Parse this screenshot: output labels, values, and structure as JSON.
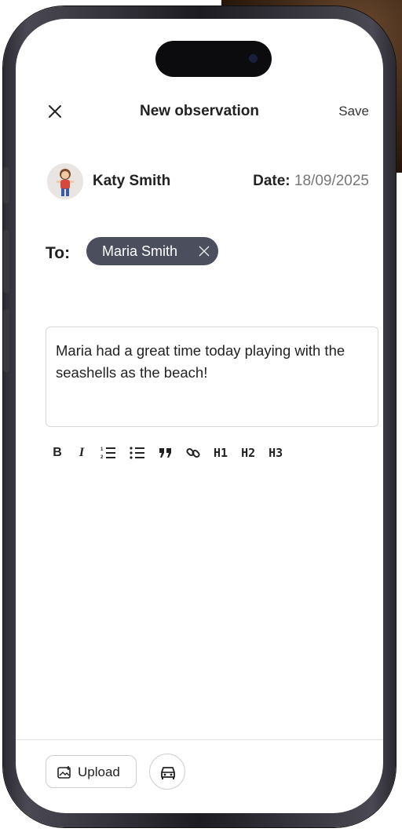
{
  "header": {
    "title": "New observation",
    "save_label": "Save",
    "close_icon": "close-icon"
  },
  "author": {
    "name": "Katy Smith",
    "date_label": "Date:",
    "date_value": "18/09/2025"
  },
  "recipients": {
    "label": "To:",
    "chips": [
      {
        "label": "Maria Smith"
      }
    ]
  },
  "note": {
    "text": "Maria had a great time today playing with the seashells as the beach!"
  },
  "toolbar": {
    "bold": "B",
    "italic": "I",
    "h1": "H1",
    "h2": "H2",
    "h3": "H3",
    "icons": [
      "bold-icon",
      "italic-icon",
      "ordered-list-icon",
      "bullet-list-icon",
      "quote-icon",
      "link-icon",
      "heading-1",
      "heading-2",
      "heading-3"
    ]
  },
  "footer": {
    "upload_label": "Upload",
    "upload_icon": "image-upload-icon",
    "second_icon": "car-icon"
  },
  "colors": {
    "chip_bg": "#4a4e5d",
    "frame": "#2b2a31",
    "text": "#222222"
  }
}
